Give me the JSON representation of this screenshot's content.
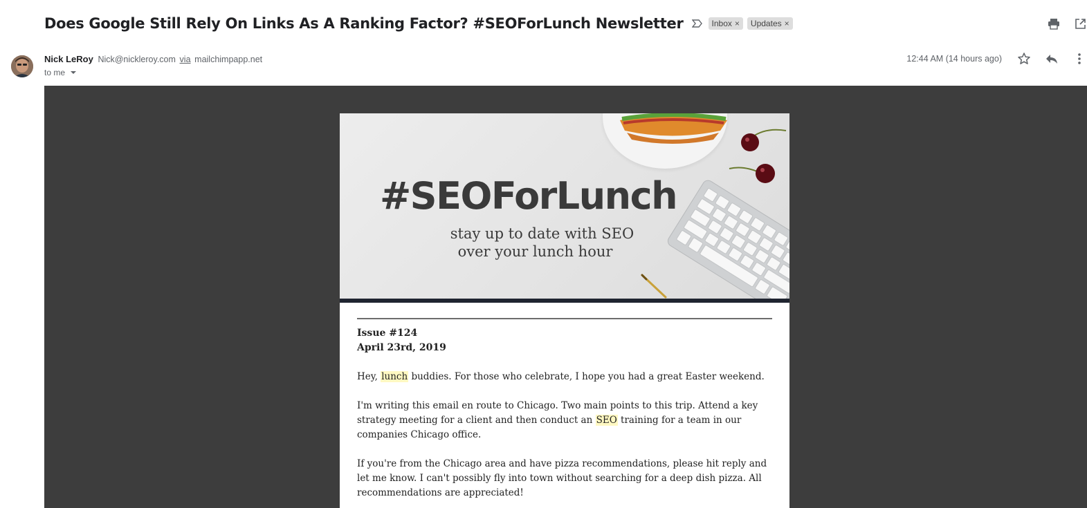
{
  "email": {
    "subject": "Does Google Still Rely On Links As A Ranking Factor? #SEOForLunch Newsletter",
    "labels": [
      "Inbox",
      "Updates"
    ],
    "label_close": "×",
    "sender_name": "Nick LeRoy",
    "sender_email": "Nick@nickleroy.com",
    "via_text": "via",
    "via_domain": "mailchimpapp.net",
    "recipient": "to me",
    "timestamp": "12:44 AM (14 hours ago)"
  },
  "icons": {
    "importance": "importance-marker-icon",
    "print": "print-icon",
    "open_new_window": "open-in-new-window-icon",
    "star": "star-icon",
    "reply": "reply-icon",
    "more": "more-vert-icon"
  },
  "newsletter": {
    "banner": {
      "title": "#SEOForLunch",
      "subtitle_line1": "stay up to date with SEO",
      "subtitle_line2": "over your lunch hour"
    },
    "issue": "Issue #124",
    "date": "April 23rd, 2019",
    "p1": {
      "before": "Hey, ",
      "highlight": "lunch",
      "after": " buddies. For those who celebrate, I hope you had a great Easter weekend."
    },
    "p2": {
      "before": "I'm writing this email en route to Chicago. Two main points to this trip. Attend a key strategy meeting for a client and then conduct an ",
      "highlight": "SEO",
      "after": " training for a team in our companies Chicago office."
    },
    "p3": "If you're from the Chicago area and have pizza recommendations, please hit reply and let me know. I can't possibly fly into town without searching for a deep dish pizza. All recommendations are appreciated!"
  },
  "colors": {
    "background_dark": "#3d3d3d",
    "label_chip": "#dddddd",
    "highlight": "#fff8c2",
    "banner_rule": "#1f2430"
  }
}
